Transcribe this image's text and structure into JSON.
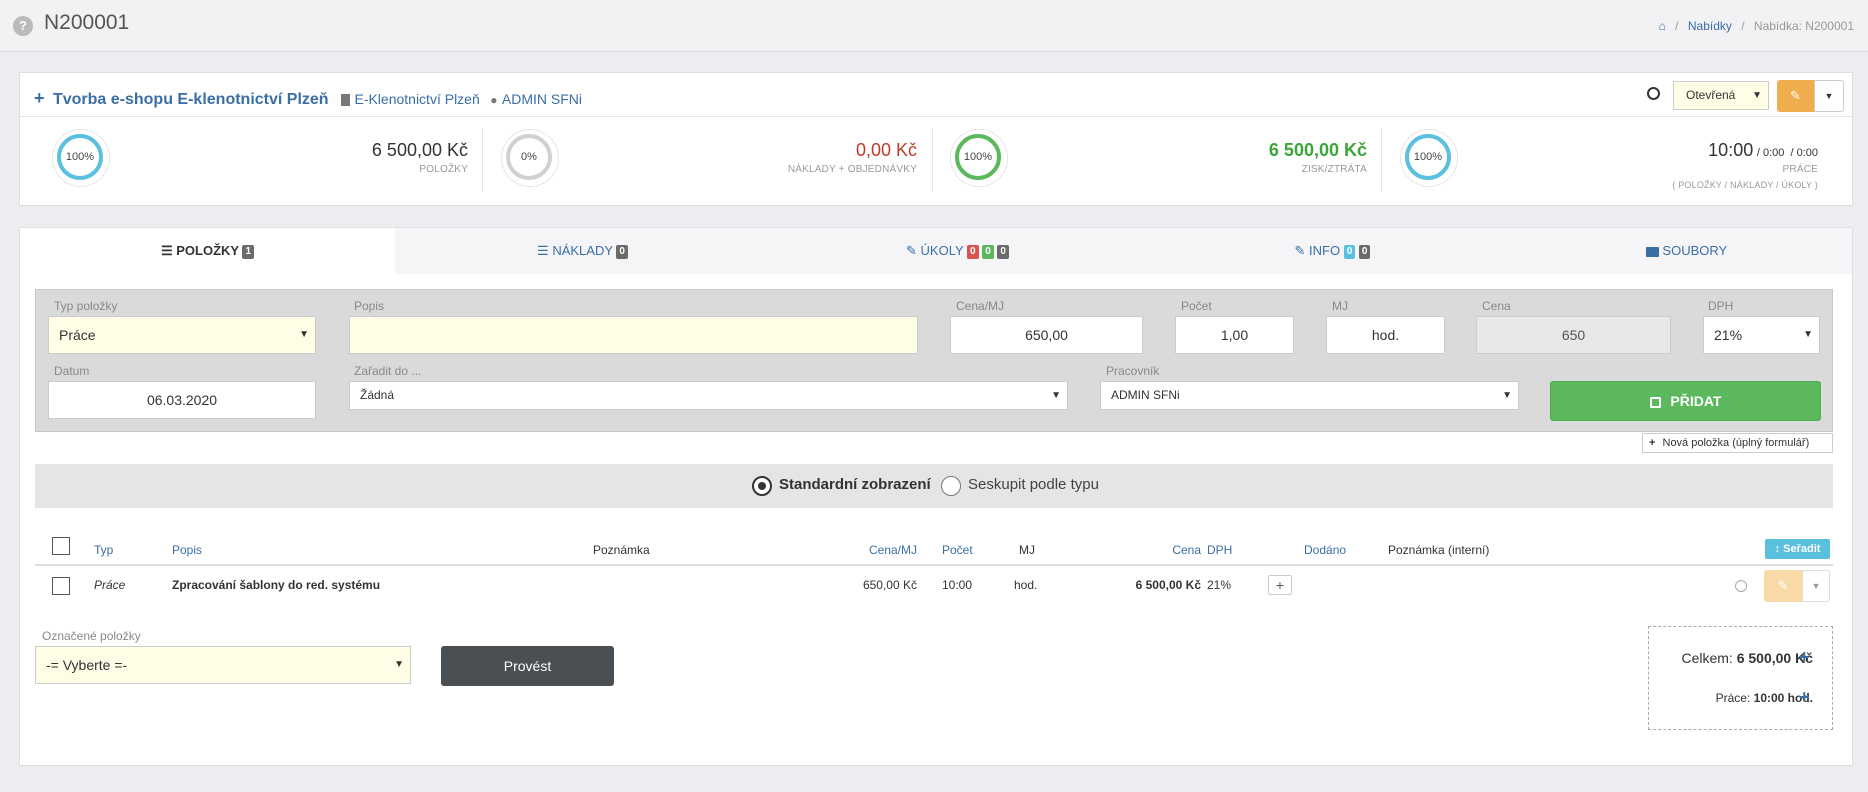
{
  "header": {
    "title": "N200001",
    "breadcrumb": {
      "level1": "Nabídky",
      "sep": "/",
      "current": "Nabídka: N200001"
    }
  },
  "offer": {
    "name": "Tvorba e-shopu E-klenotnictví Plzeň",
    "company": "E-Klenotnictví Plzeň",
    "user": "ADMIN SFNi",
    "status": "Otevřená"
  },
  "stats": [
    {
      "pct": "100%",
      "value": "6 500,00 Kč",
      "label": "POLOŽKY",
      "color": "#5bc0de"
    },
    {
      "pct": "0%",
      "value": "0,00 Kč",
      "label": "NÁKLADY + OBJEDNÁVKY",
      "color": "#d0d0d0"
    },
    {
      "pct": "100%",
      "value": "6 500,00 Kč",
      "label": "ZISK/ZTRÁTA",
      "color": "#5cb85c"
    },
    {
      "pct": "100%",
      "value_main": "10:00",
      "value_sub": "/ 0:00  / 0:00",
      "label": "PRÁCE",
      "label2": "( POLOŽKY / NÁKLADY / ÚKOLY )",
      "color": "#5bc0de"
    }
  ],
  "tabs": [
    {
      "label": "POLOŽKY",
      "badges": [
        "1"
      ]
    },
    {
      "label": "NÁKLADY",
      "badges": [
        "0"
      ]
    },
    {
      "label": "ÚKOLY",
      "badges": [
        "0",
        "0",
        "0"
      ]
    },
    {
      "label": "INFO",
      "badges": [
        "0",
        "0"
      ]
    },
    {
      "label": "SOUBORY"
    }
  ],
  "form": {
    "typ_label": "Typ položky",
    "typ_value": "Práce",
    "popis_label": "Popis",
    "popis_value": "",
    "cena_mj_label": "Cena/MJ",
    "cena_mj_value": "650,00",
    "pocet_label": "Počet",
    "pocet_value": "1,00",
    "mj_label": "MJ",
    "mj_value": "hod.",
    "cena_label": "Cena",
    "cena_value": "650",
    "dph_label": "DPH",
    "dph_value": "21%",
    "datum_label": "Datum",
    "datum_value": "06.03.2020",
    "zaradit_label": "Zařadit do ...",
    "zaradit_value": "Žádná",
    "pracovnik_label": "Pracovník",
    "pracovnik_value": "ADMIN SFNi",
    "add_button": "PŘIDAT",
    "new_full_form": "Nová položka (úplný formulář)"
  },
  "view_mode": {
    "standard": "Standardní zobrazení",
    "group": "Seskupit podle typu",
    "selected": "standard"
  },
  "table": {
    "headers": {
      "typ": "Typ",
      "popis": "Popis",
      "poznamka": "Poznámka",
      "cena_mj": "Cena/MJ",
      "pocet": "Počet",
      "mj": "MJ",
      "cena": "Cena",
      "dph": "DPH",
      "dodano": "Dodáno",
      "poznamka_int": "Poznámka (interní)",
      "sort": "Seřadit"
    },
    "rows": [
      {
        "typ": "Práce",
        "popis": "Zpracování šablony do red. systému",
        "poznamka": "",
        "cena_mj": "650,00 Kč",
        "pocet": "10:00",
        "mj": "hod.",
        "cena": "6 500,00 Kč",
        "dph": "21%"
      }
    ]
  },
  "bulk": {
    "label": "Označené položky",
    "select_value": "-= Vyberte =-",
    "button": "Provést"
  },
  "summary": {
    "total_label": "Celkem:",
    "total_value": "6 500,00 Kč",
    "work_label": "Práce:",
    "work_value": "10:00 hod."
  }
}
